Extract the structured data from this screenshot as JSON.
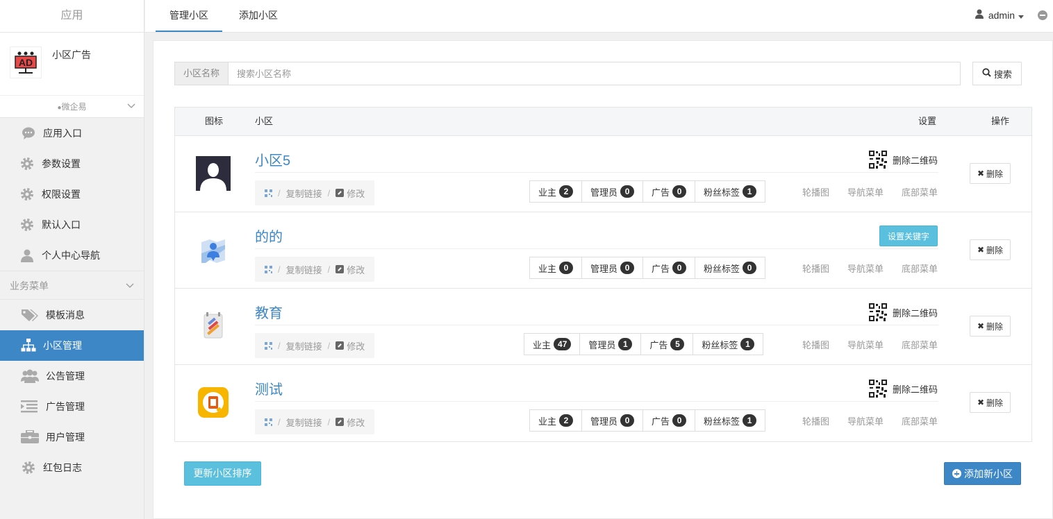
{
  "sidebar": {
    "header": "应用",
    "app_name": "小区广告",
    "wqy": "微企易",
    "items_top": [
      {
        "label": "应用入口",
        "icon": "chat-bubble-icon"
      },
      {
        "label": "参数设置",
        "icon": "gear-icon"
      },
      {
        "label": "权限设置",
        "icon": "gear-icon"
      },
      {
        "label": "默认入口",
        "icon": "gear-icon"
      },
      {
        "label": "个人中心导航",
        "icon": "user-icon"
      }
    ],
    "section_label": "业务菜单",
    "items_biz": [
      {
        "label": "模板消息",
        "icon": "tags-icon"
      },
      {
        "label": "小区管理",
        "icon": "sitemap-icon"
      },
      {
        "label": "公告管理",
        "icon": "users-icon"
      },
      {
        "label": "广告管理",
        "icon": "indent-icon"
      },
      {
        "label": "用户管理",
        "icon": "briefcase-icon"
      },
      {
        "label": "红包日志",
        "icon": "gear-icon"
      }
    ]
  },
  "topbar": {
    "tabs": [
      "管理小区",
      "添加小区"
    ],
    "user": "admin"
  },
  "search": {
    "addon": "小区名称",
    "placeholder": "搜索小区名称",
    "button": "搜索"
  },
  "table": {
    "headers": {
      "icon": "图标",
      "community": "小区",
      "settings": "设置",
      "ops": "操作"
    },
    "actions": {
      "copy_link": "复制链接",
      "edit": "修改"
    },
    "stat_labels": {
      "owner": "业主",
      "admin": "管理员",
      "ad": "广告",
      "fans": "粉丝标签"
    },
    "links": [
      "轮播图",
      "导航菜单",
      "底部菜单"
    ],
    "delete_qr": "删除二维码",
    "set_keyword": "设置关键字",
    "delete": "删除",
    "rows": [
      {
        "name": "小区5",
        "icon": "avatar-placeholder-icon",
        "setting": "qr",
        "owner": "2",
        "admin": "0",
        "ad": "0",
        "fans": "1"
      },
      {
        "name": "的的",
        "icon": "map-pin-icon",
        "setting": "keyword",
        "owner": "0",
        "admin": "0",
        "ad": "0",
        "fans": "0"
      },
      {
        "name": "教育",
        "icon": "education-icon",
        "setting": "qr",
        "owner": "47",
        "admin": "1",
        "ad": "5",
        "fans": "1"
      },
      {
        "name": "测试",
        "icon": "office-icon",
        "setting": "qr",
        "owner": "2",
        "admin": "0",
        "ad": "0",
        "fans": "1"
      }
    ]
  },
  "footer": {
    "sort": "更新小区排序",
    "add": "添加新小区"
  },
  "colors": {
    "primary": "#3d87c6",
    "info": "#5bc0de"
  }
}
